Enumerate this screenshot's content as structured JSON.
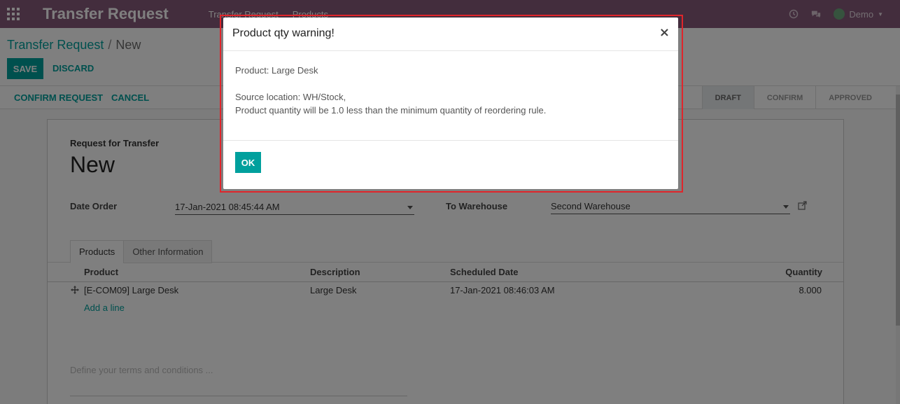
{
  "navbar": {
    "app_title": "Transfer Request",
    "menu": [
      "Transfer Request",
      "Products"
    ],
    "user_name": "Demo",
    "background": "#875a7b"
  },
  "breadcrumb": {
    "parent": "Transfer Request",
    "separator": "/",
    "current": "New"
  },
  "control_panel": {
    "save_label": "SAVE",
    "discard_label": "DISCARD"
  },
  "statusbar": {
    "confirm_request_label": "CONFIRM REQUEST",
    "cancel_label": "CANCEL",
    "stages": [
      {
        "label": "DRAFT",
        "active": true
      },
      {
        "label": "CONFIRM",
        "active": false
      },
      {
        "label": "APPROVED",
        "active": false
      }
    ]
  },
  "form": {
    "request_label": "Request for Transfer",
    "name": "New",
    "date_order_label": "Date Order",
    "date_order_value": "17-Jan-2021 08:45:44 AM",
    "to_warehouse_label": "To Warehouse",
    "to_warehouse_value": "Second Warehouse",
    "tabs": [
      "Products",
      "Other Information"
    ],
    "table": {
      "headers": [
        "Product",
        "Description",
        "Scheduled Date",
        "Quantity"
      ],
      "rows": [
        {
          "product": "[E-COM09] Large Desk",
          "description": "Large Desk",
          "scheduled_date": "17-Jan-2021 08:46:03 AM",
          "quantity": "8.000"
        }
      ],
      "add_line": "Add a line"
    },
    "terms_placeholder": "Define your terms and conditions ..."
  },
  "modal": {
    "title": "Product qty warning!",
    "close": "×",
    "body_line1": "Product: Large Desk",
    "body_line2": "Source location: WH/Stock,",
    "body_line3": "Product quantity will be 1.0 less than the minimum quantity of reordering rule.",
    "ok_label": "OK"
  },
  "colors": {
    "accent": "#00a09d",
    "highlight_outline": "#e0252b"
  }
}
